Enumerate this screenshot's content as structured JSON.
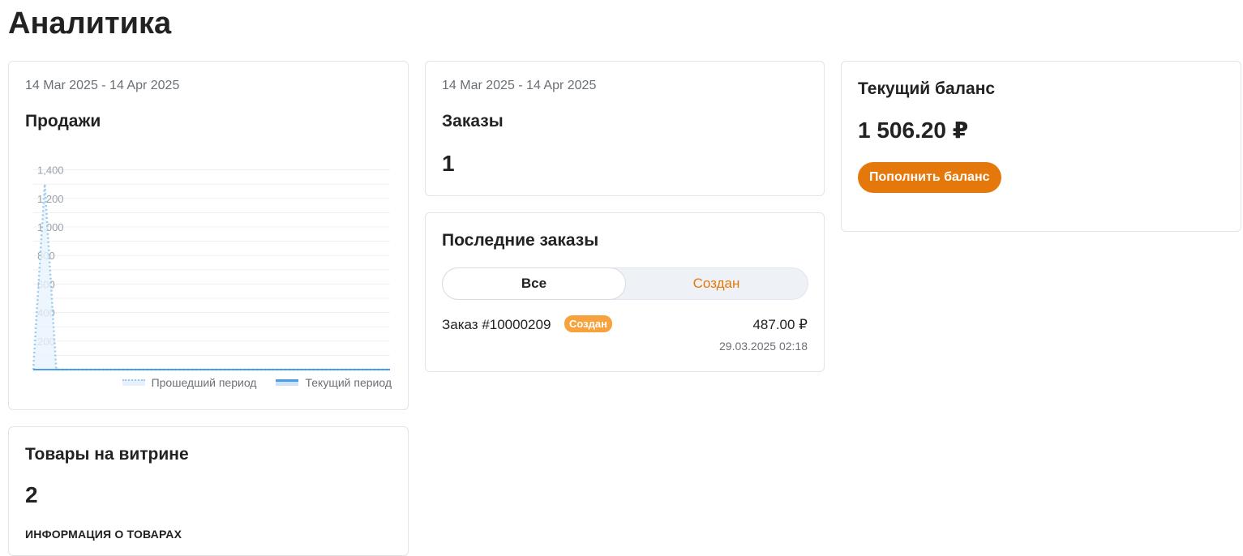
{
  "page": {
    "title": "Аналитика"
  },
  "sales": {
    "date_range": "14 Mar 2025 - 14 Apr 2025",
    "title": "Продажи"
  },
  "orders": {
    "date_range": "14 Mar 2025 - 14 Apr 2025",
    "title": "Заказы",
    "count": "1"
  },
  "balance": {
    "title": "Текущий баланс",
    "amount": "1 506.20 ₽",
    "topup_label": "Пополнить баланс",
    "accent_color": "#e5780b"
  },
  "recent_orders": {
    "title": "Последние заказы",
    "tabs": [
      {
        "label": "Все",
        "active": true
      },
      {
        "label": "Создан",
        "active": false
      }
    ],
    "items": [
      {
        "name": "Заказ #10000209",
        "status": "Создан",
        "amount": "487.00 ₽",
        "date": "29.03.2025 02:18"
      }
    ]
  },
  "products": {
    "title": "Товары на витрине",
    "count": "2",
    "info_heading": "ИНФОРМАЦИЯ О ТОВАРАХ"
  },
  "chart_data": {
    "type": "area",
    "title": "Продажи",
    "xlabel": "",
    "ylabel": "",
    "ylim": [
      0,
      1400
    ],
    "y_ticks": [
      "200",
      "400",
      "600",
      "800",
      "1,000",
      "1,200",
      "1,400"
    ],
    "y_tick_values": [
      200,
      400,
      600,
      800,
      1000,
      1200,
      1400
    ],
    "grid": true,
    "legend_position": "bottom-right",
    "x_count": 32,
    "series": [
      {
        "name": "Прошедший период",
        "style": "dotted",
        "color": "#9ccaf0",
        "values": [
          0,
          1300,
          0,
          0,
          0,
          0,
          0,
          0,
          0,
          0,
          0,
          0,
          0,
          0,
          0,
          0,
          0,
          0,
          0,
          0,
          0,
          0,
          0,
          0,
          0,
          0,
          0,
          0,
          0,
          0,
          0,
          0
        ]
      },
      {
        "name": "Текущий период",
        "style": "solid",
        "color": "#4a9de6",
        "values": [
          0,
          0,
          0,
          0,
          0,
          0,
          0,
          0,
          0,
          0,
          0,
          0,
          0,
          0,
          0,
          0,
          0,
          0,
          0,
          0,
          0,
          0,
          0,
          0,
          0,
          0,
          0,
          0,
          0,
          0,
          0,
          0
        ]
      }
    ]
  }
}
